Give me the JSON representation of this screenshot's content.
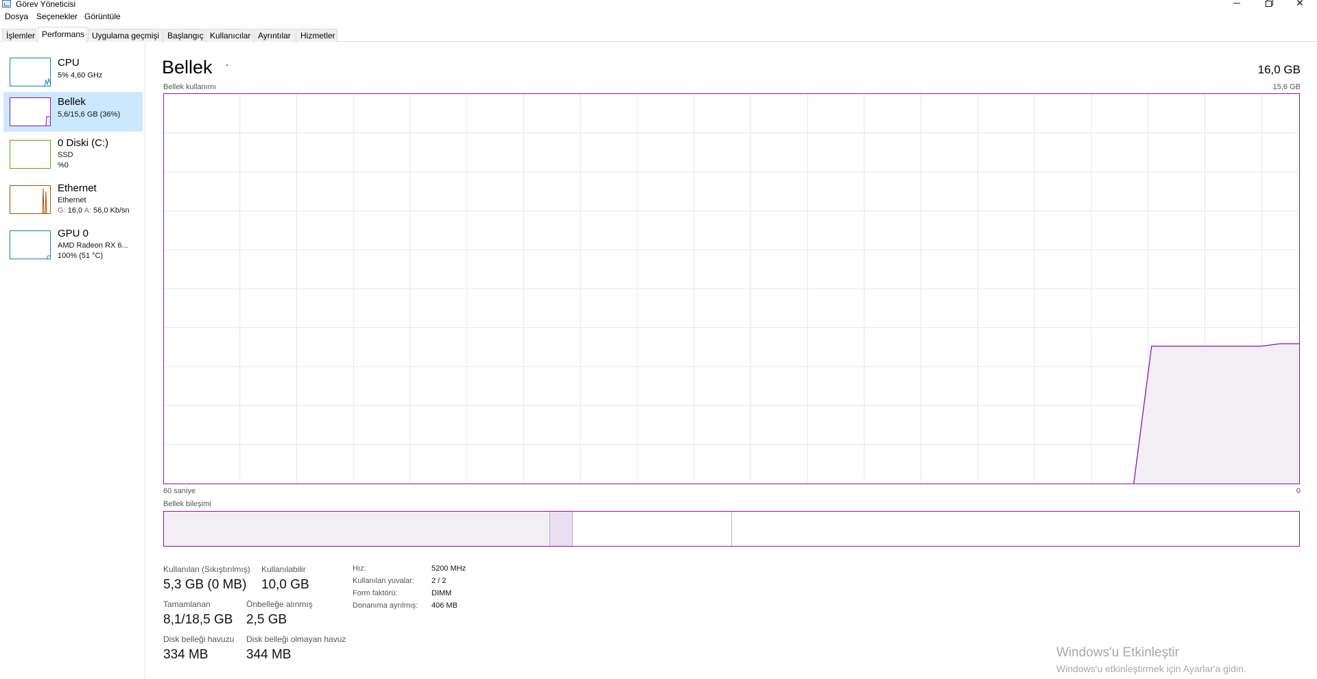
{
  "window": {
    "title": "Görev Yöneticisi",
    "controls": {
      "minimize": "─",
      "close": "✕"
    }
  },
  "menu": [
    "Dosya",
    "Seçenekler",
    "Görüntüle"
  ],
  "tabs": [
    {
      "label": "İşlemler",
      "active": false
    },
    {
      "label": "Performans",
      "active": true
    },
    {
      "label": "Uygulama geçmişi",
      "active": false
    },
    {
      "label": "Başlangıç",
      "active": false
    },
    {
      "label": "Kullanıcılar",
      "active": false
    },
    {
      "label": "Ayrıntılar",
      "active": false
    },
    {
      "label": "Hizmetler",
      "active": false
    }
  ],
  "sidebar": {
    "items": [
      {
        "title": "CPU",
        "line1": "5%  4,60 GHz",
        "line2": "",
        "color": "#117dbb",
        "selected": false
      },
      {
        "title": "Bellek",
        "line1": "5,6/15,6 GB (36%)",
        "line2": "",
        "color": "#8b12ae",
        "selected": true
      },
      {
        "title": "0 Diski (C:)",
        "line1": "SSD",
        "line2": "%0",
        "color": "#4da60c",
        "selected": false
      },
      {
        "title": "Ethernet",
        "line1": "Ethernet",
        "line2_prefix_send": "G:",
        "line2_send": "16,0",
        "line2_prefix_recv": "A:",
        "line2_recv": "56,0 Kb/sn",
        "color": "#a74f01",
        "selected": false
      },
      {
        "title": "GPU 0",
        "line1": "AMD Radeon RX 6...",
        "line2": "100%  (51 °C)",
        "color": "#117dbb",
        "selected": false
      }
    ]
  },
  "main": {
    "title": "Bellek",
    "total": "16,0 GB",
    "usage_label": "Bellek kullanımı",
    "usage_max": "15,6 GB",
    "time_left": "60 saniye",
    "time_right": "0",
    "composition_label": "Bellek bileşimi",
    "accent_color": "#8b12ae",
    "fill_color": "#f1eef4"
  },
  "chart_data": {
    "type": "area",
    "title": "Bellek kullanımı",
    "xlabel": "",
    "ylabel": "",
    "x_range": [
      "60 saniye",
      "0"
    ],
    "ylim": [
      0,
      15.6
    ],
    "y_unit": "GB",
    "grid": true,
    "x": [
      60,
      10,
      7.8,
      6,
      4,
      2,
      1,
      0
    ],
    "y": [
      null,
      null,
      5.5,
      5.5,
      5.5,
      5.5,
      5.6,
      5.6
    ]
  },
  "composition": {
    "in_use_fraction": 0.34,
    "modified_fraction": 0.02,
    "standby_fraction": 0.14,
    "free_fraction": 0.5
  },
  "stats": {
    "in_use_label": "Kullanılan (Sıkıştırılmış)",
    "in_use_value": "5,3 GB (0 MB)",
    "available_label": "Kullanılabilir",
    "available_value": "10,0 GB",
    "committed_label": "Tamamlanan",
    "committed_value": "8,1/18,5 GB",
    "cached_label": "Önbelleğe alınmış",
    "cached_value": "2,5 GB",
    "paged_label": "Disk belleği havuzu",
    "paged_value": "334 MB",
    "nonpaged_label": "Disk belleği olmayan havuz",
    "nonpaged_value": "344 MB"
  },
  "details": [
    {
      "key": "Hız:",
      "value": "5200 MHz"
    },
    {
      "key": "Kullanılan yuvalar:",
      "value": "2 / 2"
    },
    {
      "key": "Form faktörü:",
      "value": "DIMM"
    },
    {
      "key": "Donanıma ayrılmış:",
      "value": "406 MB"
    }
  ],
  "watermark": {
    "line1": "Windows'u Etkinleştir",
    "line2": "Windows'u etkinleştirmek için Ayarlar'a gidin."
  }
}
